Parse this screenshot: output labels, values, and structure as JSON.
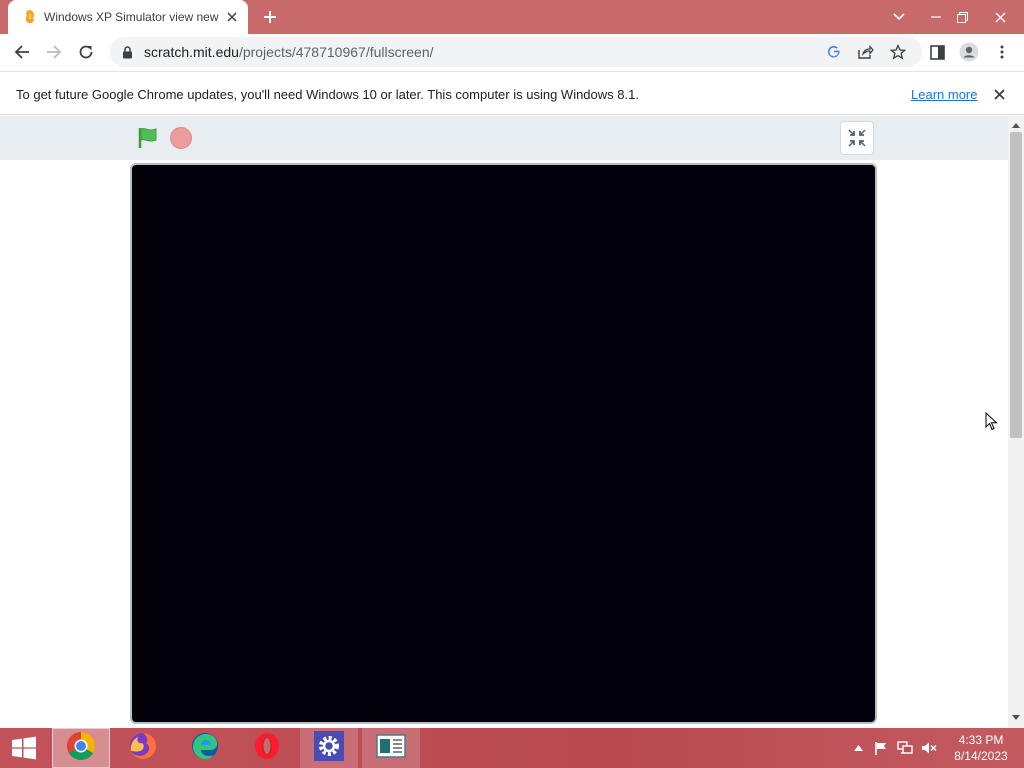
{
  "browser": {
    "tab_title": "Windows XP Simulator view new",
    "url_host": "scratch.mit.edu",
    "url_path": "/projects/478710967/fullscreen/"
  },
  "infobar": {
    "message": "To get future Google Chrome updates, you'll need Windows 10 or later. This computer is using Windows 8.1.",
    "link_label": "Learn more"
  },
  "taskbar": {
    "time": "4:33 PM",
    "date": "8/14/2023"
  },
  "colors": {
    "titlebar": "#c96a6a",
    "taskbar": "#bd4f57",
    "stage": "#03020a",
    "link": "#1a73e8"
  },
  "icons": [
    "scratch-favicon-icon",
    "close-icon",
    "plus-icon",
    "chevron-down-icon",
    "minimize-icon",
    "restore-icon",
    "back-icon",
    "forward-icon",
    "reload-icon",
    "lock-icon",
    "google-icon",
    "share-icon",
    "star-icon",
    "side-panel-icon",
    "profile-icon",
    "kebab-menu-icon",
    "green-flag-icon",
    "stop-icon",
    "unfullscreen-icon",
    "windows-start-icon",
    "chrome-icon",
    "firefox-icon",
    "edge-icon",
    "opera-icon",
    "settings-icon",
    "news-icon",
    "flag-icon",
    "network-icon",
    "volume-muted-icon"
  ]
}
